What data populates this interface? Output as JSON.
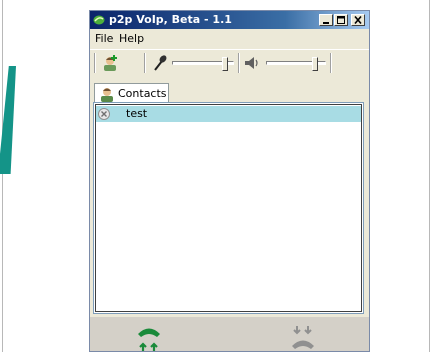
{
  "window": {
    "title": "p2p VoIp, Beta - 1.1"
  },
  "menu": {
    "items": [
      "File",
      "Help"
    ]
  },
  "toolbar": {
    "mic_level": 0.9,
    "speaker_level": 0.85
  },
  "tabs": {
    "contacts_label": "Contacts"
  },
  "contacts": {
    "rows": [
      {
        "name": "test"
      }
    ]
  },
  "colors": {
    "accent_green": "#1a8a3a",
    "row_highlight": "#a8dce4",
    "title_start": "#0a246a",
    "title_end": "#a6caf0"
  }
}
